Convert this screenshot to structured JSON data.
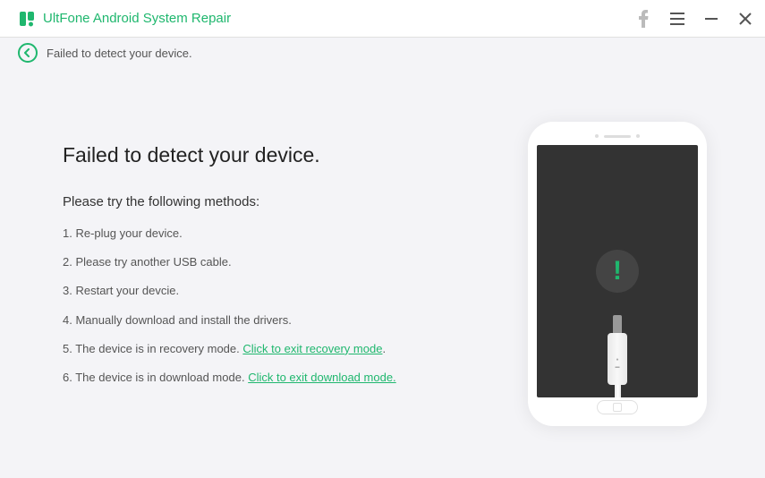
{
  "header": {
    "app_title": "UltFone Android System Repair"
  },
  "status": {
    "message": "Failed to detect your device."
  },
  "main": {
    "heading": "Failed to detect your device.",
    "subheading": "Please try the following methods:",
    "methods": [
      "Re-plug your device.",
      "Please try another USB cable.",
      "Restart your devcie.",
      "Manually download and install the drivers."
    ],
    "method5_prefix": "The device is in recovery mode. ",
    "method5_link": "Click to exit recovery mode",
    "method5_suffix": ".",
    "method6_prefix": "The device is in download mode. ",
    "method6_link": "Click to exit download mode.",
    "method6_suffix": ""
  }
}
